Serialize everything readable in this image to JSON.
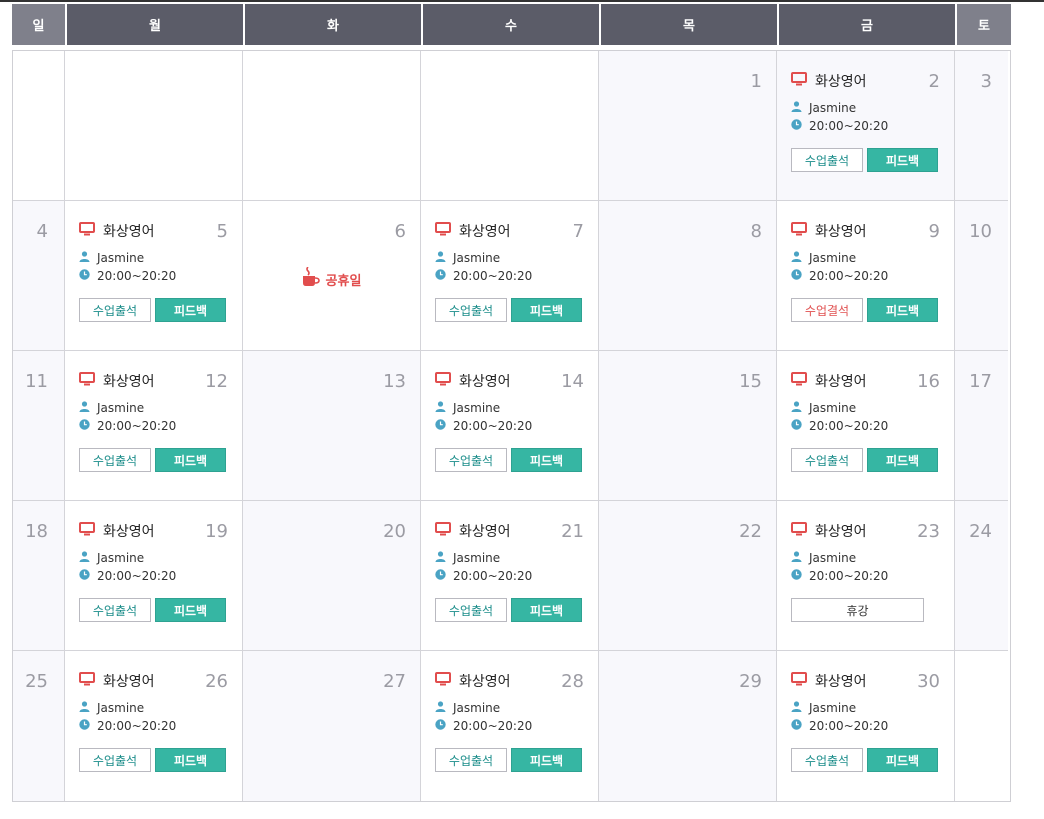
{
  "weekdays": [
    "일",
    "월",
    "화",
    "수",
    "목",
    "금",
    "토"
  ],
  "lesson": {
    "title": "화상영어",
    "teacher": "Jasmine",
    "time": "20:00~20:20",
    "attend_label": "수업출석",
    "absent_label": "수업결석",
    "feedback_label": "피드백",
    "rest_label": "휴강"
  },
  "holiday_label": "공휴일",
  "colors": {
    "header": "#5b5c68",
    "weekend_header": "#7f808b",
    "feedback": "#36b6a3",
    "icon_red": "#e14d4d",
    "icon_blue": "#4aa3c4"
  },
  "weeks": [
    [
      {
        "day": ""
      },
      {
        "day": ""
      },
      {
        "day": ""
      },
      {
        "day": ""
      },
      {
        "day": "1",
        "shaded": true
      },
      {
        "day": "2",
        "lesson": true,
        "status": "attend",
        "shaded": true
      },
      {
        "day": "3",
        "shaded": true
      }
    ],
    [
      {
        "day": "4",
        "shaded": true
      },
      {
        "day": "5",
        "lesson": true,
        "status": "attend"
      },
      {
        "day": "6",
        "holiday": true
      },
      {
        "day": "7",
        "lesson": true,
        "status": "attend"
      },
      {
        "day": "8",
        "shaded": true
      },
      {
        "day": "9",
        "lesson": true,
        "status": "absent"
      },
      {
        "day": "10",
        "shaded": true
      }
    ],
    [
      {
        "day": "11",
        "shaded": true
      },
      {
        "day": "12",
        "lesson": true,
        "status": "attend"
      },
      {
        "day": "13",
        "shaded": true
      },
      {
        "day": "14",
        "lesson": true,
        "status": "attend"
      },
      {
        "day": "15",
        "shaded": true
      },
      {
        "day": "16",
        "lesson": true,
        "status": "attend"
      },
      {
        "day": "17",
        "shaded": true
      }
    ],
    [
      {
        "day": "18",
        "shaded": true
      },
      {
        "day": "19",
        "lesson": true,
        "status": "attend"
      },
      {
        "day": "20",
        "shaded": true
      },
      {
        "day": "21",
        "lesson": true,
        "status": "attend"
      },
      {
        "day": "22",
        "shaded": true
      },
      {
        "day": "23",
        "lesson": true,
        "status": "rest"
      },
      {
        "day": "24",
        "shaded": true
      }
    ],
    [
      {
        "day": "25",
        "shaded": true
      },
      {
        "day": "26",
        "lesson": true,
        "status": "attend"
      },
      {
        "day": "27",
        "shaded": true
      },
      {
        "day": "28",
        "lesson": true,
        "status": "attend"
      },
      {
        "day": "29",
        "shaded": true
      },
      {
        "day": "30",
        "lesson": true,
        "status": "attend"
      },
      {
        "day": ""
      }
    ]
  ]
}
